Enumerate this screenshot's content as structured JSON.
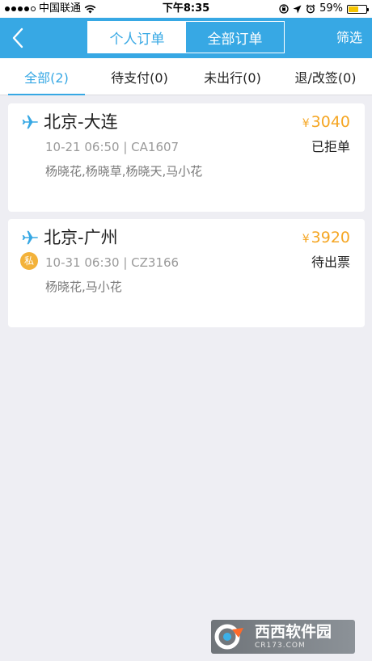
{
  "status_bar": {
    "carrier": "中国联通",
    "time": "下午8:35",
    "battery": "59%",
    "battery_level": 0.59
  },
  "nav": {
    "segments": [
      {
        "label": "个人订单",
        "active": true
      },
      {
        "label": "全部订单",
        "active": false
      }
    ],
    "filter_label": "筛选"
  },
  "tabs": [
    {
      "label": "全部(2)",
      "active": true
    },
    {
      "label": "待支付(0)",
      "active": false
    },
    {
      "label": "未出行(0)",
      "active": false
    },
    {
      "label": "退/改签(0)",
      "active": false
    }
  ],
  "orders": [
    {
      "route": "北京-大连",
      "currency": "¥",
      "price": "3040",
      "flight_info": "10-21 06:50 | CA1607",
      "status": "已拒单",
      "passengers": "杨晓花,杨晓草,杨晓天,马小花",
      "private_badge": ""
    },
    {
      "route": "北京-广州",
      "currency": "¥",
      "price": "3920",
      "flight_info": "10-31 06:30 | CZ3166",
      "status": "待出票",
      "passengers": "杨晓花,马小花",
      "private_badge": "私"
    }
  ],
  "watermark": {
    "text": "西西软件园",
    "sub": "CR173.COM"
  },
  "colors": {
    "accent": "#37a8e4",
    "price": "#f5a623",
    "badge": "#f3b23a",
    "background": "#eeeef3"
  },
  "icons": {
    "back": "chevron-left-icon",
    "flight": "plane-icon",
    "wifi": "wifi-icon",
    "lock": "orientation-lock-icon",
    "location": "location-arrow-icon",
    "alarm": "alarm-clock-icon"
  }
}
